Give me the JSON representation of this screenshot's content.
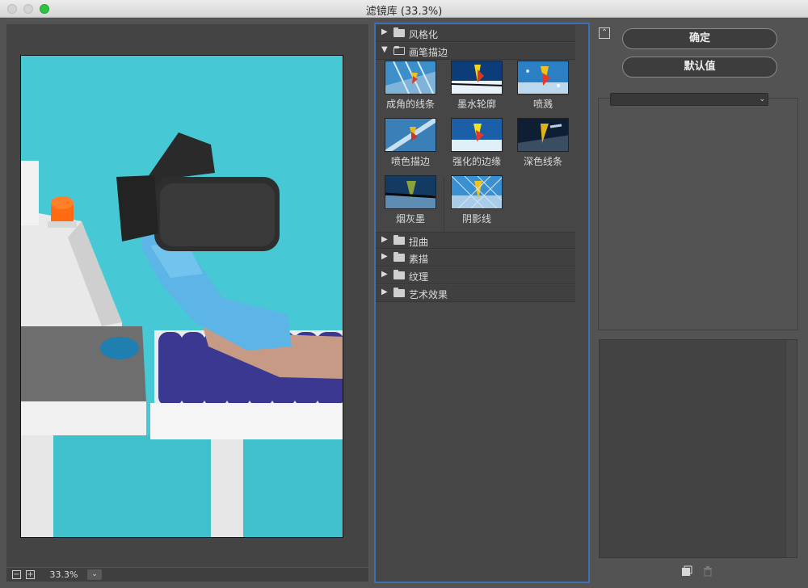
{
  "window": {
    "title": "滤镜库 (33.3%)"
  },
  "preview": {
    "zoom": "33.3%",
    "zoom_out": "−",
    "zoom_in": "+"
  },
  "filters": {
    "categories": [
      {
        "label": "风格化",
        "expanded": false
      },
      {
        "label": "画笔描边",
        "expanded": true
      },
      {
        "label": "扭曲",
        "expanded": false
      },
      {
        "label": "素描",
        "expanded": false
      },
      {
        "label": "纹理",
        "expanded": false
      },
      {
        "label": "艺术效果",
        "expanded": false
      }
    ],
    "brush_strokes": [
      {
        "label": "成角的线条",
        "icon": "angled-strokes-thumb"
      },
      {
        "label": "墨水轮廓",
        "icon": "ink-outlines-thumb"
      },
      {
        "label": "喷溅",
        "icon": "spatter-thumb"
      },
      {
        "label": "喷色描边",
        "icon": "sprayed-strokes-thumb"
      },
      {
        "label": "强化的边缘",
        "icon": "accented-edges-thumb"
      },
      {
        "label": "深色线条",
        "icon": "dark-strokes-thumb"
      },
      {
        "label": "烟灰墨",
        "icon": "sumi-e-thumb"
      },
      {
        "label": "阴影线",
        "icon": "crosshatch-thumb"
      }
    ]
  },
  "actions": {
    "ok_label": "确定",
    "default_label": "默认值"
  },
  "settings": {
    "selected_filter": ""
  },
  "icons": {
    "expand": "collapse-double-arrow-icon",
    "new_layer": "new-effect-layer-icon",
    "delete": "trash-icon"
  },
  "colors": {
    "accent": "#3d6fb5",
    "panel": "#535353",
    "preview_bg": "#46c9d4"
  }
}
